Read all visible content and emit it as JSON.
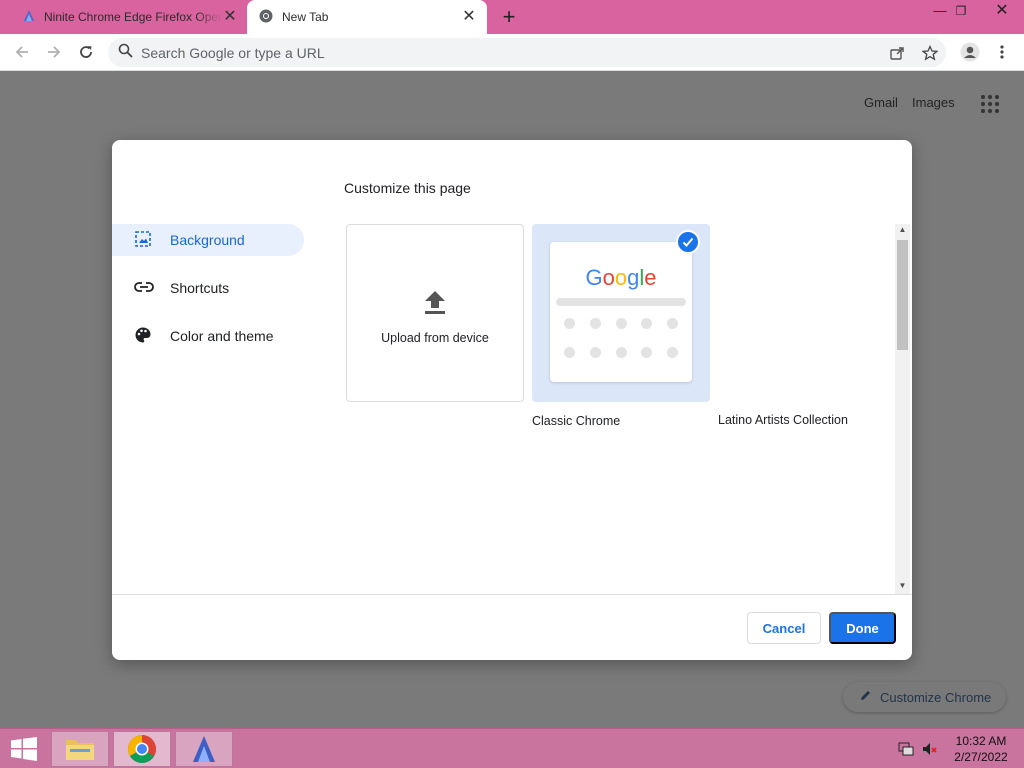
{
  "browser": {
    "tabs": [
      {
        "label": "Ninite Chrome Edge Firefox Opera",
        "active": false
      },
      {
        "label": "New Tab",
        "active": true
      }
    ],
    "omnibox": {
      "placeholder": "Search Google or type a URL"
    }
  },
  "page": {
    "links": {
      "gmail": "Gmail",
      "images": "Images"
    },
    "customize_chrome_label": "Customize Chrome"
  },
  "dialog": {
    "title": "Customize this page",
    "sidebar": [
      {
        "label": "Background",
        "icon": "image-icon",
        "selected": true
      },
      {
        "label": "Shortcuts",
        "icon": "link-icon",
        "selected": false
      },
      {
        "label": "Color and theme",
        "icon": "palette-icon",
        "selected": false
      }
    ],
    "tiles": {
      "upload": "Upload from device",
      "classic": "Classic Chrome",
      "collection": "Latino Artists Collection",
      "google_logo": "Google"
    },
    "buttons": {
      "cancel": "Cancel",
      "done": "Done"
    }
  },
  "taskbar": {
    "time": "10:32 AM",
    "date": "2/27/2022"
  },
  "colors": {
    "tabstrip": "#d9639f",
    "accent": "#1a73e8",
    "taskbar": "#c9739f"
  }
}
